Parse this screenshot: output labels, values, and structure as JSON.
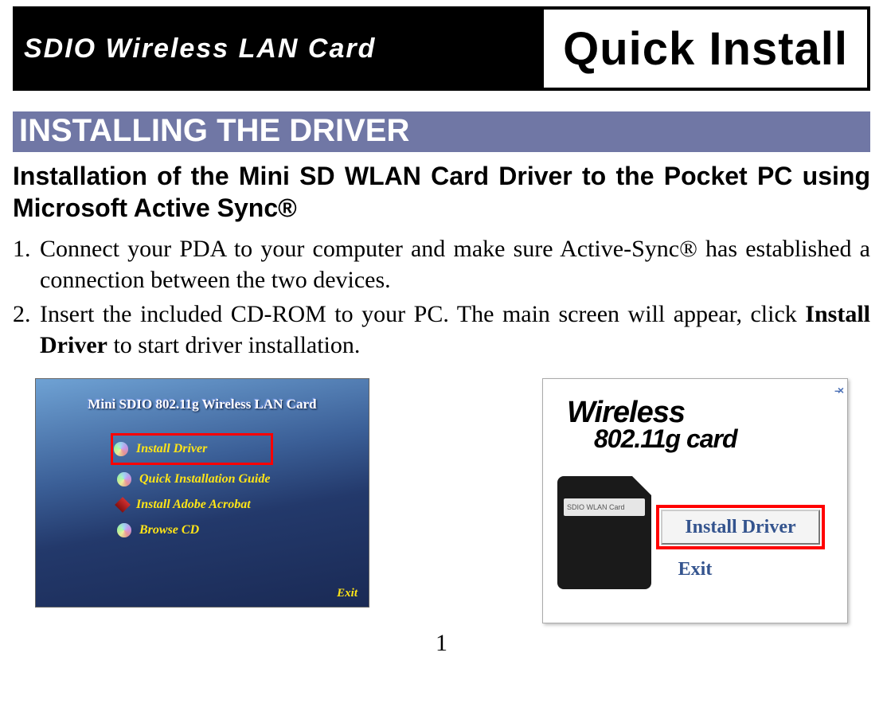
{
  "banner": {
    "left": "SDIO Wireless LAN Card",
    "right": "Quick Install"
  },
  "section_heading": "INSTALLING THE DRIVER",
  "sub_heading": "Installation of the Mini SD WLAN Card Driver to the Pocket PC using Microsoft Active Sync®",
  "steps": [
    {
      "num": "1.",
      "text": "Connect your PDA to your computer and make sure Active-Sync® has established a connection between the two devices."
    },
    {
      "num": "2.",
      "text_a": "Insert the included CD-ROM to your PC. The main screen will appear, click ",
      "bold": "Install Driver",
      "text_b": " to start driver installation."
    }
  ],
  "shot_left": {
    "title": "Mini SDIO 802.11g Wireless LAN Card",
    "items": [
      "Install Driver",
      "Quick Installation Guide",
      "Install Adobe Acrobat",
      "Browse CD"
    ],
    "exit": "Exit"
  },
  "shot_right": {
    "title_l1": "Wireless",
    "title_l2": "802.11g card",
    "card_label": "SDIO WLAN Card",
    "install_btn": "Install Driver",
    "exit": "Exit",
    "win_btn": "–  ×"
  },
  "page_number": "1"
}
